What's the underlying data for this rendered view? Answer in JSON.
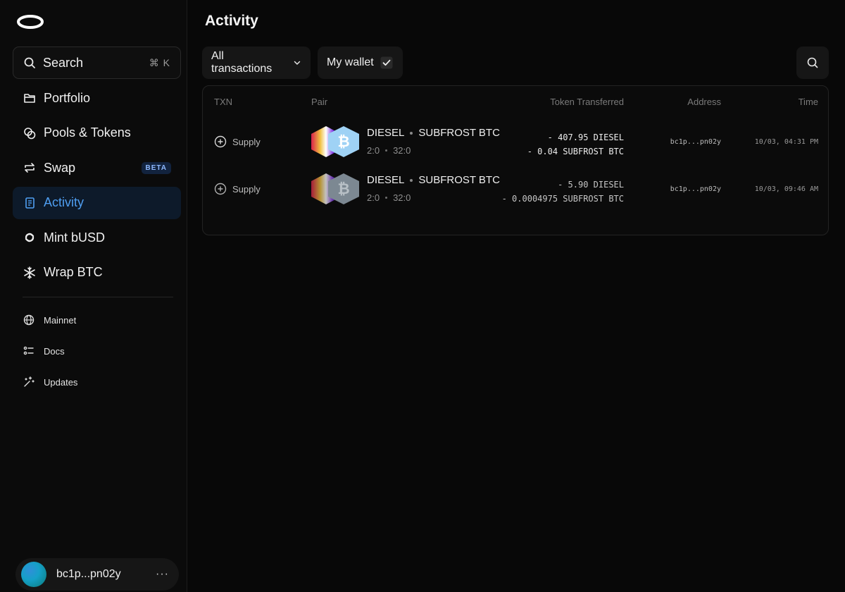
{
  "sidebar": {
    "search": {
      "label": "Search",
      "shortcut": "⌘ K"
    },
    "nav": [
      {
        "label": "Portfolio",
        "icon": "folder-icon"
      },
      {
        "label": "Pools & Tokens",
        "icon": "coins-icon"
      },
      {
        "label": "Swap",
        "icon": "swap-icon",
        "badge": "BETA"
      },
      {
        "label": "Activity",
        "icon": "activity-icon",
        "active": true
      },
      {
        "label": "Mint bUSD",
        "icon": "mint-icon"
      },
      {
        "label": "Wrap BTC",
        "icon": "snowflake-icon"
      }
    ],
    "sub_nav": [
      {
        "label": "Mainnet",
        "icon": "globe-icon"
      },
      {
        "label": "Docs",
        "icon": "docs-icon"
      },
      {
        "label": "Updates",
        "icon": "sparkle-icon"
      }
    ],
    "user": {
      "address": "bc1p...pn02y",
      "more": "···"
    }
  },
  "main": {
    "title": "Activity",
    "filters": {
      "transactions_label": "All transactions",
      "wallet_label": "My wallet",
      "wallet_checked": true
    },
    "table": {
      "headers": {
        "txn": "TXN",
        "pair": "Pair",
        "token": "Token Transferred",
        "address": "Address",
        "time": "Time"
      },
      "rows": [
        {
          "txn": "Supply",
          "token_a": "DIESEL",
          "token_b": "SUBFROST BTC",
          "id_a": "2:0",
          "id_b": "32:0",
          "amount_a": "- 407.95 DIESEL",
          "amount_b": "- 0.04 SUBFROST BTC",
          "address": "bc1p...pn02y",
          "time": "10/03, 04:31 PM"
        },
        {
          "txn": "Supply",
          "token_a": "DIESEL",
          "token_b": "SUBFROST BTC",
          "id_a": "2:0",
          "id_b": "32:0",
          "amount_a": "- 5.90 DIESEL",
          "amount_b": "- 0.0004975 SUBFROST BTC",
          "address": "bc1p...pn02y",
          "time": "10/03, 09:46 AM"
        }
      ]
    }
  },
  "colors": {
    "accent": "#4f9ff2",
    "active_bg": "#0d1a2a",
    "background": "#080808",
    "btc_icon": "#9fd2f5"
  }
}
